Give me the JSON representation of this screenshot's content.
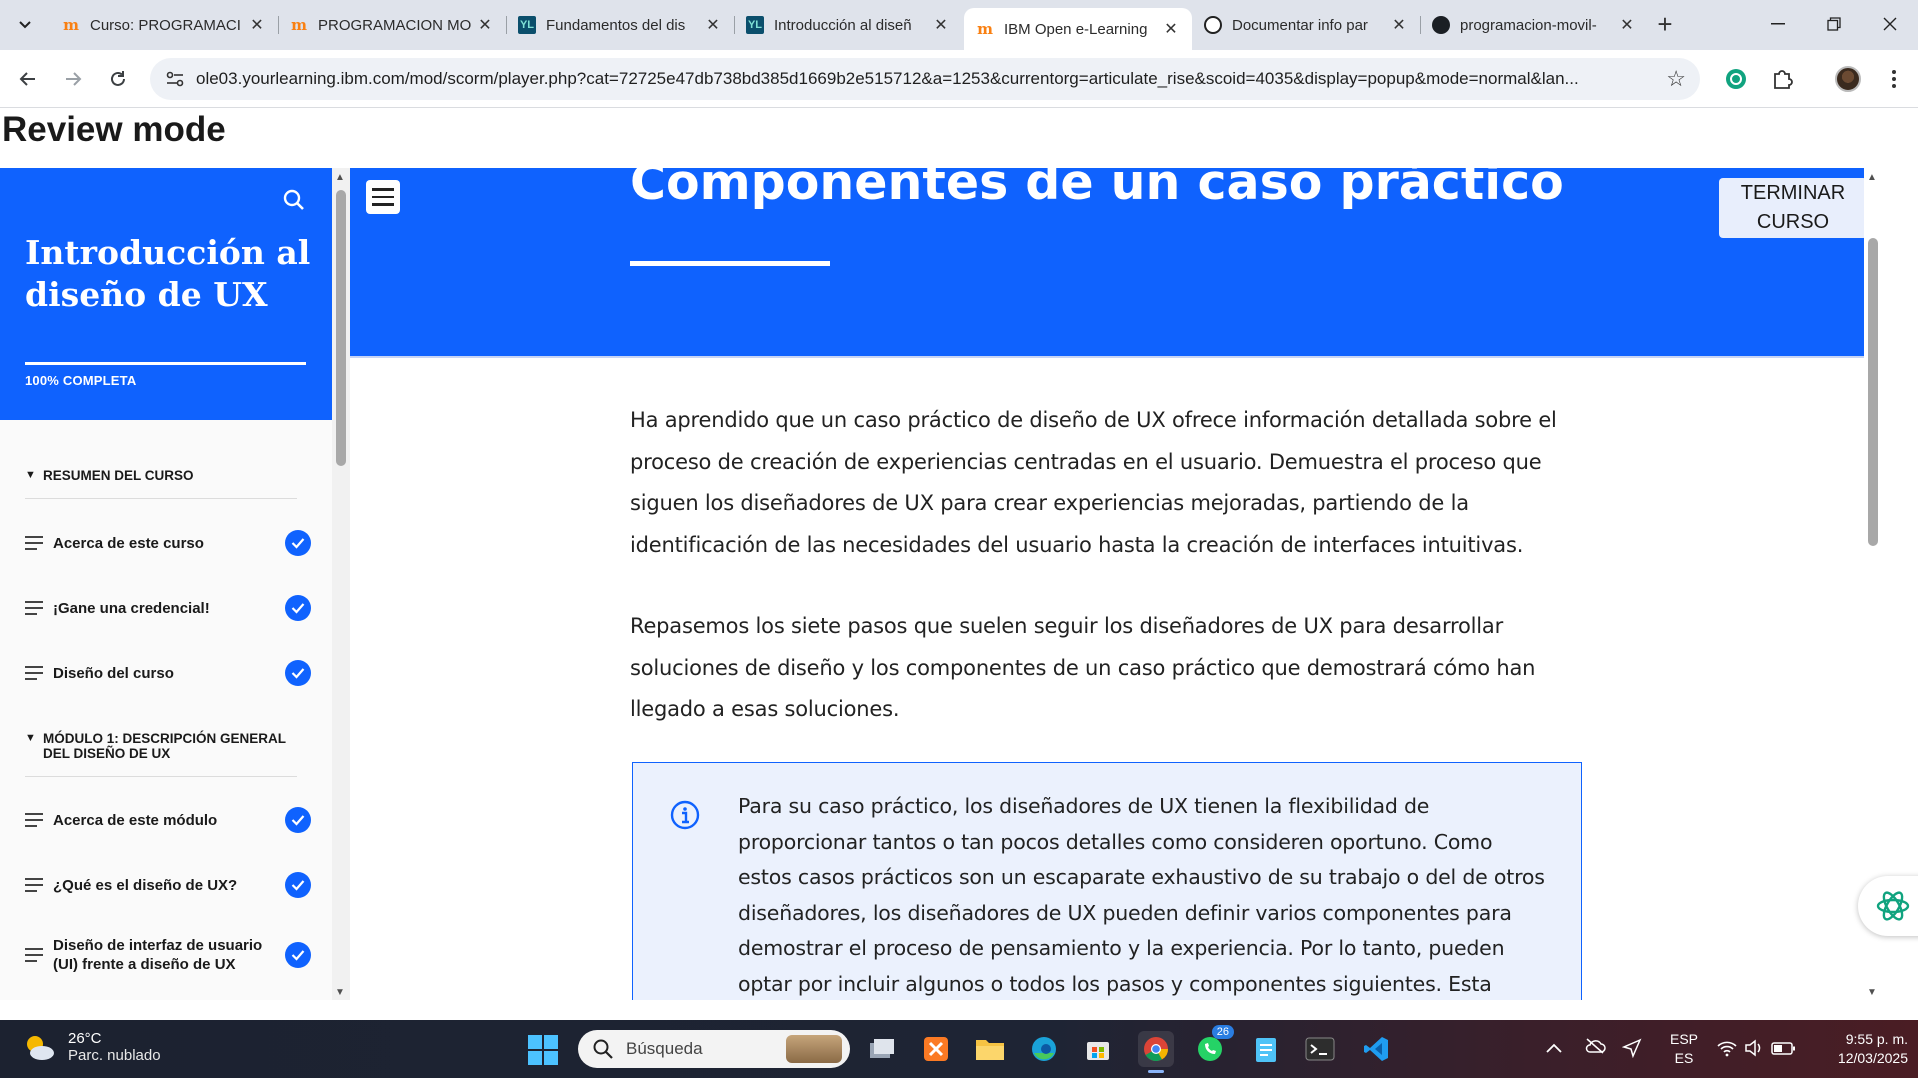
{
  "browser": {
    "tabs": [
      {
        "title": "Curso: PROGRAMACI",
        "favicon": "moodle-icon",
        "active": false
      },
      {
        "title": "PROGRAMACION MO",
        "favicon": "moodle-icon",
        "active": false
      },
      {
        "title": "Fundamentos del dis",
        "favicon": "yourlearning-icon",
        "active": false
      },
      {
        "title": "Introducción al diseñ",
        "favicon": "yourlearning-icon",
        "active": false
      },
      {
        "title": "IBM Open e-Learning",
        "favicon": "moodle-icon",
        "active": true
      },
      {
        "title": "Documentar info par",
        "favicon": "chatgpt-icon",
        "active": false
      },
      {
        "title": "programacion-movil-",
        "favicon": "github-icon",
        "active": false
      }
    ],
    "url": "ole03.yourlearning.ibm.com/mod/scorm/player.php?cat=72725e47db738bd385d1669b2e515712&a=1253&currentorg=articulate_rise&scoid=4035&display=popup&mode=normal&lan..."
  },
  "page": {
    "mode_label": "Review mode"
  },
  "sidebar": {
    "course_title": "Introducción al diseño de UX",
    "progress_label": "100% COMPLETA",
    "progress_fraction": 1.0,
    "sections": [
      {
        "label": "RESUMEN DEL CURSO",
        "lessons": [
          {
            "label": "Acerca de este curso",
            "complete": true
          },
          {
            "label": "¡Gane una credencial!",
            "complete": true
          },
          {
            "label": "Diseño del curso",
            "complete": true
          }
        ]
      },
      {
        "label": "MÓDULO 1: DESCRIPCIÓN GENERAL DEL DISEÑO DE UX",
        "lessons": [
          {
            "label": "Acerca de este módulo",
            "complete": true
          },
          {
            "label": "¿Qué es el diseño de UX?",
            "complete": true
          },
          {
            "label": "Diseño de interfaz de usuario (UI) frente a diseño de UX",
            "complete": true
          }
        ]
      }
    ]
  },
  "main": {
    "lesson_title": "Componentes de un caso práctico",
    "finish_button": "TERMINAR CURSO",
    "paragraphs": [
      "Ha aprendido que un caso práctico de diseño de UX ofrece información detallada sobre el proceso de creación de experiencias centradas en el usuario. Demuestra el proceso que siguen los diseñadores de UX para crear experiencias mejoradas, partiendo de la identificación de las necesidades del usuario hasta la creación de interfaces intuitivas.",
      "Repasemos los siete pasos que suelen seguir los diseñadores de UX para desarrollar soluciones de diseño y los componentes de un caso práctico que demostrará cómo han llegado a esas soluciones."
    ],
    "note": "Para su caso práctico, los diseñadores de UX tienen la flexibilidad de proporcionar tantos o tan pocos detalles como consideren oportuno. Como estos casos prácticos son un escaparate exhaustivo de su trabajo o del de otros diseñadores, los diseñadores de UX pueden definir varios componentes para demostrar el proceso de pensamiento y la experiencia. Por lo tanto, pueden optar por incluir algunos o todos los pasos y componentes siguientes. Esta decisión depende de cuánta información"
  },
  "taskbar": {
    "weather_temp": "26°C",
    "weather_desc": "Parc. nublado",
    "search_placeholder": "Búsqueda",
    "whatsapp_badge": "26",
    "lang_1": "ESP",
    "lang_2": "ES",
    "time": "9:55 p. m.",
    "date": "12/03/2025"
  },
  "colors": {
    "accent": "#0f62fe",
    "tabstrip": "#dfe3eb"
  }
}
